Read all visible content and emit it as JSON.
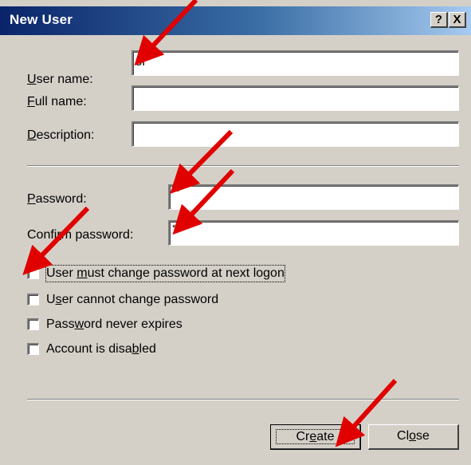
{
  "window": {
    "title": "New User",
    "help_btn": "?",
    "close_btn": "X"
  },
  "fields": {
    "user_name": {
      "label_u": "U",
      "label_rest": "ser name:",
      "value": "sf"
    },
    "full_name": {
      "label_u": "F",
      "label_rest": "ull name:",
      "value": ""
    },
    "description": {
      "label_u": "D",
      "label_rest": "escription:",
      "value": ""
    },
    "password": {
      "label_u": "P",
      "label_rest": "assword:",
      "value": "**"
    },
    "confirm_password": {
      "label_pre": "Confi",
      "label_u": "r",
      "label_rest": "m password:",
      "value": "**"
    }
  },
  "checkboxes": [
    {
      "pre": "User ",
      "u": "m",
      "rest": "ust change password at next logon",
      "checked": false
    },
    {
      "pre": "U",
      "u": "s",
      "rest": "er cannot change password",
      "checked": false
    },
    {
      "pre": "Pass",
      "u": "w",
      "rest": "ord never expires",
      "checked": false
    },
    {
      "pre": "Account is disa",
      "u": "b",
      "rest": "led",
      "checked": false
    }
  ],
  "buttons": {
    "create": {
      "pre": "Cr",
      "u": "e",
      "rest": "ate"
    },
    "close": {
      "pre": "Cl",
      "u": "o",
      "rest": "se"
    }
  },
  "colors": {
    "dialog_bg": "#d4d0c8",
    "title_start": "#0a246a",
    "title_end": "#a6caf0",
    "annotation_arrow": "#e00000"
  }
}
